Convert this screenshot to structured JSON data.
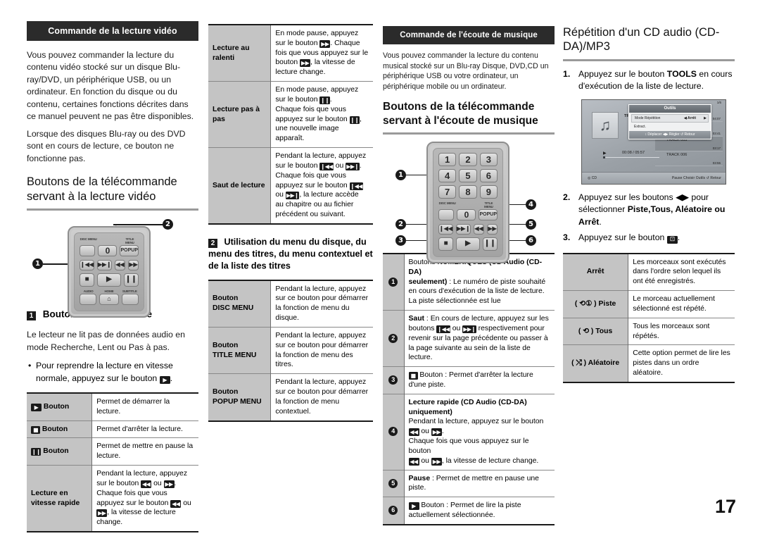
{
  "page_number": "17",
  "col1": {
    "section_header": "Commande de la lecture vidéo",
    "intro_p1": "Vous pouvez commander la lecture du contenu vidéo stocké sur un disque Blu-ray/DVD, un périphérique USB, ou un ordinateur. En fonction du disque ou du contenu, certaines fonctions décrites dans ce manuel peuvent ne pas être disponibles.",
    "intro_p2": "Lorsque des disques Blu-ray ou des DVD sont en cours de lecture, ce bouton ne fonctionne pas.",
    "heading": "Boutons de la télécommande servant à la lecture vidéo",
    "remote": {
      "label_disc_menu": "DISC MENU",
      "label_title_menu": "TITLE MENU",
      "key_zero": "0",
      "key_popup": "POPUP",
      "label_audio": "AUDIO",
      "label_home": "HOME",
      "label_subtitle": "SUBTITLE",
      "callout_1": "1",
      "callout_2": "2"
    },
    "subhead_marker": "1",
    "subhead": "Boutons liés à la lecture",
    "note": "Le lecteur ne lit pas de données audio en mode Recherche, Lent ou Pas à pas.",
    "bullet": "Pour reprendre la lecture en vitesse normale, appuyez sur le bouton",
    "table": [
      {
        "key_icon": "play",
        "key": "Bouton",
        "value": "Permet de démarrer la lecture."
      },
      {
        "key_icon": "stop",
        "key": "Bouton",
        "value": "Permet d'arrêter la lecture."
      },
      {
        "key_icon": "pause",
        "key": "Bouton",
        "value": "Permet de mettre en pause la lecture."
      },
      {
        "key_icon": "",
        "key": "Lecture en vitesse rapide",
        "value": "Pendant la lecture, appuyez sur le bouton ◀◀ ou ▶▶. Chaque fois que vous appuyez sur le bouton ◀◀ ou ▶▶, la vitesse de lecture change."
      }
    ]
  },
  "col2": {
    "table_top": [
      {
        "key": "Lecture au ralenti",
        "value": "En mode pause, appuyez sur le bouton ▶▶. Chaque fois que vous appuyez sur le bouton ▶▶, la vitesse de lecture change."
      },
      {
        "key": "Lecture pas à pas",
        "value": "En mode pause, appuyez sur le bouton ❙❙. Chaque fois que vous appuyez sur le bouton ❙❙, une nouvelle image apparaît."
      },
      {
        "key": "Saut de lecture",
        "value": "Pendant la lecture, appuyez sur le bouton ◀◀❙ ou ❙▶▶. Chaque fois que vous appuyez sur le bouton ◀◀❙ ou ❙▶▶, la lecture accède au chapitre ou au fichier précédent ou suivant."
      }
    ],
    "subhead_marker": "2",
    "subhead": "Utilisation du menu du disque, du menu des titres, du menu contextuel et de la liste des titres",
    "table_bottom": [
      {
        "key_line1": "Bouton",
        "key_line2": "DISC MENU",
        "value": "Pendant la lecture, appuyez sur ce bouton pour démarrer la fonction de menu du disque."
      },
      {
        "key_line1": "Bouton",
        "key_line2": "TITLE MENU",
        "value": "Pendant la lecture, appuyez sur ce bouton pour démarrer la fonction de menu des titres."
      },
      {
        "key_line1": "Bouton",
        "key_line2": "POPUP MENU",
        "value": "Pendant la lecture, appuyez sur ce bouton pour démarrer la fonction de menu contextuel."
      }
    ]
  },
  "col3": {
    "section_header": "Commande de l'écoute de musique",
    "intro": "Vous pouvez commander la lecture du contenu musical stocké sur un Blu-ray Disque, DVD,CD un périphérique USB ou votre ordinateur, un périphérique mobile ou un ordinateur.",
    "heading": "Boutons de la télécommande servant à l'écoute de musique",
    "remote": {
      "keys": [
        "1",
        "2",
        "3",
        "4",
        "5",
        "6",
        "7",
        "8",
        "9"
      ],
      "key_zero": "0",
      "key_popup": "POPUP",
      "label_disc_menu": "DISC MENU",
      "label_title_menu": "TITLE MENU",
      "callouts": [
        "1",
        "2",
        "3",
        "4",
        "5",
        "6"
      ]
    },
    "table": [
      {
        "num": "1",
        "value": "Boutons NUMÉRIQUES (CD Audio (CD-DA) seulement) : Le numéro de piste souhaité en cours d'exécution de la liste de lecture. La piste sélectionnée est lue",
        "bold_lead": "Boutons NUMÉRIQUES (CD Audio (CD-DA) seulement)"
      },
      {
        "num": "2",
        "value": "Saut : En cours de lecture, appuyez sur les boutons ◀◀❙ ou ❙▶▶ respectivement pour revenir sur la page précédente ou passer à la page suivante au sein de la liste de lecture.",
        "bold_lead": "Saut"
      },
      {
        "num": "3",
        "value": "Bouton : Permet d'arrêter la lecture d'une piste.",
        "icon": "stop"
      },
      {
        "num": "4",
        "value": "Lecture rapide (CD Audio (CD-DA) uniquement) Pendant la lecture, appuyez sur le bouton ◀◀ ou ▶▶. Chaque fois que vous appuyez sur le bouton ◀◀ ou ▶▶, la vitesse de lecture change.",
        "bold_lead": "Lecture rapide (CD Audio (CD-DA) uniquement)"
      },
      {
        "num": "5",
        "value": "Pause : Permet de mettre en pause une piste.",
        "bold_lead": "Pause"
      },
      {
        "num": "6",
        "value": "Bouton : Permet de lire la piste actuellement sélectionnée.",
        "icon": "play"
      }
    ]
  },
  "col4": {
    "heading": "Répétition d'un CD audio (CD-DA)/MP3",
    "steps": [
      {
        "n": "1.",
        "text_a": "Appuyez sur le bouton ",
        "bold": "TOOLS",
        "text_b": " en cours d'exécution de la liste de lecture."
      },
      {
        "n": "2.",
        "text_a": "Appuyez sur les boutons ◀▶ pour sélectionner ",
        "bold": "Piste,Tous, Aléatoire ou Arrêt",
        "text_b": "."
      },
      {
        "n": "3.",
        "text_a": "Appuyez sur le bouton ",
        "bold": "",
        "text_b": "."
      }
    ],
    "tv": {
      "track_label": "TRACK 001",
      "time": "00:08 / 05:57",
      "page_indicator": "1/6",
      "list": [
        {
          "name": "TRACK 003",
          "dur": "04:07",
          "selected": false
        },
        {
          "name": "TRACK 004",
          "dur": "03:41",
          "selected": false
        },
        {
          "name": "TRACK 005",
          "dur": "03:17",
          "selected": true
        },
        {
          "name": "TRACK 006",
          "dur": "03:55",
          "selected": false
        }
      ],
      "tools": {
        "title": "Outils",
        "row_label": "Mode Répétition",
        "row_value": "Arrêt",
        "row2": "Extract.",
        "footer": "↕ Déplacer  ◀▶ Régler  ↺ Retour"
      },
      "source": "CD",
      "bottom_hints": "Pause    Choisir    Outils   ↺ Retour"
    },
    "table": [
      {
        "key": "Arrêt",
        "value": "Les morceaux sont exécutés dans l'ordre selon lequel ils ont été enregistrés.",
        "icon": ""
      },
      {
        "key": "Piste",
        "value": "Le morceau actuellement sélectionné est répété.",
        "icon": "repeat-one"
      },
      {
        "key": "Tous",
        "value": "Tous les morceaux sont répétés.",
        "icon": "repeat-all"
      },
      {
        "key": "Aléatoire",
        "value": "Cette option permet de lire les pistes dans un ordre aléatoire.",
        "icon": "shuffle"
      }
    ]
  }
}
